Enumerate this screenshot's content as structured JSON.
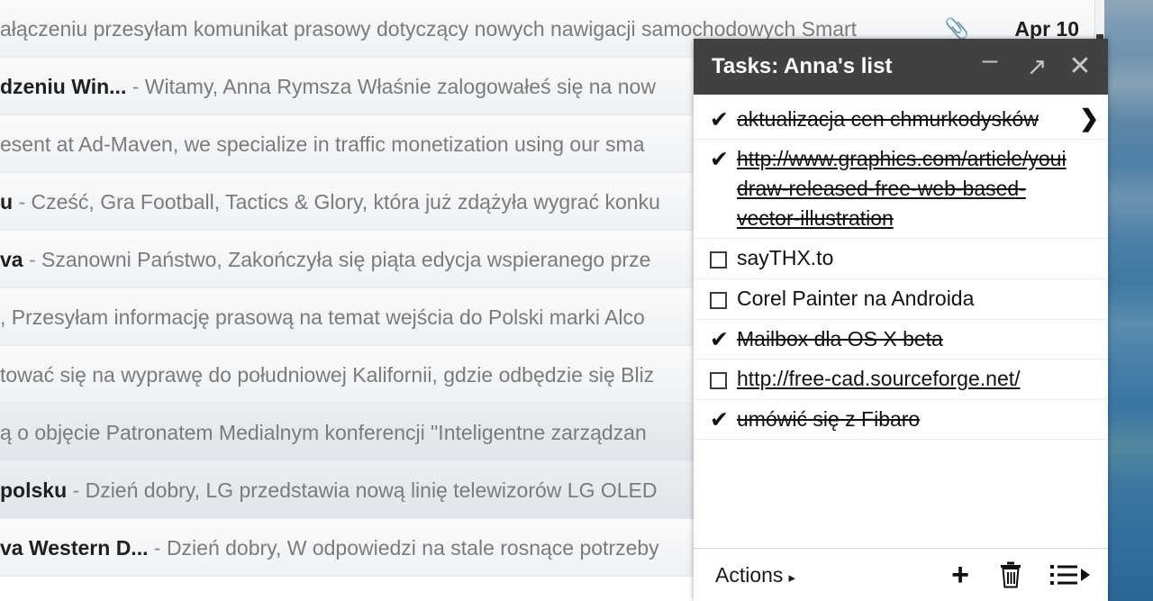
{
  "mail_list": {
    "rows": [
      {
        "sender": "",
        "dash": "",
        "snippet": "ałączeniu przesyłam komunikat prasowy dotyczący nowych nawigacji samochodowych Smart",
        "attachment_icon": "paperclip-icon",
        "date": "Apr 10",
        "read": false
      },
      {
        "sender": "dzeniu Win...",
        "dash": "-",
        "snippet": "Witamy, Anna Rymsza Właśnie zalogowałeś się na now",
        "attachment_icon": "",
        "date": "",
        "read": false
      },
      {
        "sender": "",
        "dash": "",
        "snippet": "esent at Ad-Maven, we specialize in traffic monetization using our sma",
        "attachment_icon": "",
        "date": "",
        "read": false
      },
      {
        "sender": "u",
        "dash": "-",
        "snippet": "Cześć, Gra Football, Tactics & Glory, która już zdążyła wygrać konku",
        "attachment_icon": "",
        "date": "",
        "read": false
      },
      {
        "sender": "va",
        "dash": "-",
        "snippet": "Szanowni Państwo, Zakończyła się piąta edycja wspieranego prze",
        "attachment_icon": "",
        "date": "",
        "read": false
      },
      {
        "sender": "",
        "dash": "",
        "snippet": ", Przesyłam informację prasową na temat wejścia do Polski marki Alco",
        "attachment_icon": "",
        "date": "",
        "read": false
      },
      {
        "sender": "",
        "dash": "",
        "snippet": "tować się na wyprawę do południowej Kalifornii, gdzie odbędzie się Bliz",
        "attachment_icon": "",
        "date": "",
        "read": false
      },
      {
        "sender": "",
        "dash": "",
        "snippet": "ą o objęcie Patronatem Medialnym konferencji \"Inteligentne zarządzan",
        "attachment_icon": "",
        "date": "",
        "read": true
      },
      {
        "sender": "polsku",
        "dash": "-",
        "snippet": "Dzień dobry, LG przedstawia nową linię telewizorów LG OLED",
        "attachment_icon": "",
        "date": "",
        "read": true
      },
      {
        "sender": "va Western D...",
        "dash": "-",
        "snippet": "Dzień dobry, W odpowiedzi na stale rosnące potrzeby",
        "attachment_icon": "",
        "date": "",
        "read": false
      }
    ]
  },
  "tasks_panel": {
    "title": "Tasks: Anna's list",
    "window_controls": {
      "minimize": "–",
      "popout": "↗",
      "close": "✕"
    },
    "tasks": [
      {
        "text": "aktualizacja cen chmurkodysków",
        "done": true,
        "is_link": false,
        "chevron": "❯",
        "hovered": true
      },
      {
        "text": "http://www.graphics.com/article/youidraw-released-free-web-based-vector-illustration",
        "done": true,
        "is_link": true,
        "chevron": "",
        "hovered": false
      },
      {
        "text": "sayTHX.to",
        "done": false,
        "is_link": false,
        "chevron": "",
        "hovered": false
      },
      {
        "text": "Corel Painter na Androida",
        "done": false,
        "is_link": false,
        "chevron": "",
        "hovered": false
      },
      {
        "text": "Mailbox dla OS X beta",
        "done": true,
        "is_link": false,
        "chevron": "",
        "hovered": false
      },
      {
        "text": "http://free-cad.sourceforge.net/",
        "done": false,
        "is_link": true,
        "chevron": "",
        "hovered": false
      },
      {
        "text": "umówić się z Fibaro",
        "done": true,
        "is_link": false,
        "chevron": "",
        "hovered": false
      }
    ],
    "check_glyph": "✔",
    "footer": {
      "actions_label": "Actions",
      "actions_caret": "▸",
      "add_label": "+",
      "delete_icon": "trash-icon",
      "switch_list_icon": "list-icon",
      "switch_list_caret": "▸"
    }
  },
  "colors": {
    "titlebar_bg": "#414141",
    "panel_bg": "#ffffff",
    "desktop_accent": "#3f79a3"
  }
}
